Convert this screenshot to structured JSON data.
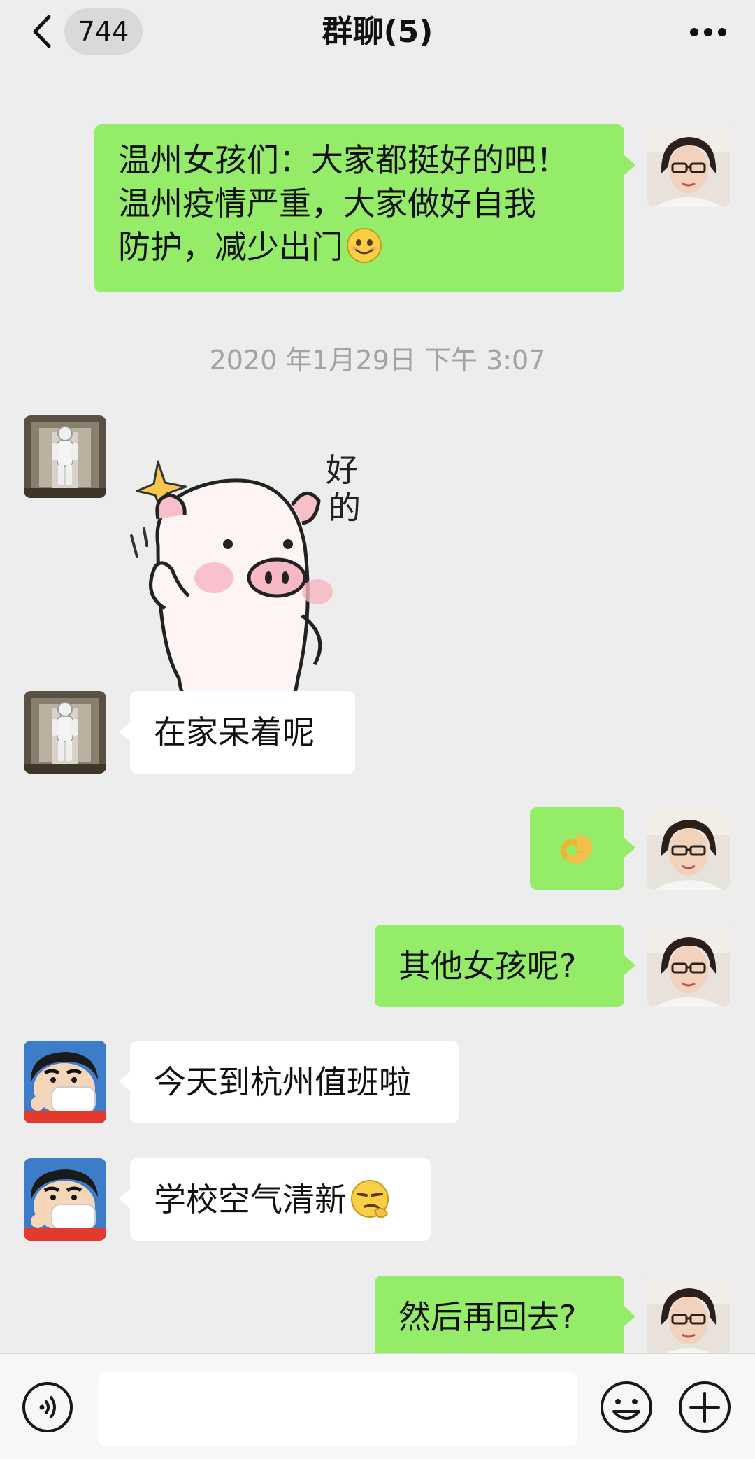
{
  "header": {
    "unread_count": "744",
    "title": "群聊(5)"
  },
  "messages": {
    "m1": {
      "line1": "温州女孩们：大家都挺好的吧！",
      "line2": "温州疫情严重，大家做好自我",
      "line3": "防护，减少出门",
      "emoji": "smile-emoji"
    },
    "timestamp": "2020 年1月29日 下午 3:07",
    "sticker": {
      "caption_char1": "好",
      "caption_char2": "的",
      "name": "pig-ok-sticker"
    },
    "m3": {
      "text": "在家呆着呢"
    },
    "m4": {
      "emoji": "ok-hand-emoji"
    },
    "m5": {
      "text": "其他女孩呢?"
    },
    "m6": {
      "text": "今天到杭州值班啦"
    },
    "m7": {
      "text": "学校空气清新",
      "emoji": "smirk-emoji"
    },
    "m8": {
      "text": "然后再回去?"
    }
  },
  "colors": {
    "outgoing_bubble": "#95ec69",
    "incoming_bubble": "#ffffff",
    "background": "#ededed"
  }
}
